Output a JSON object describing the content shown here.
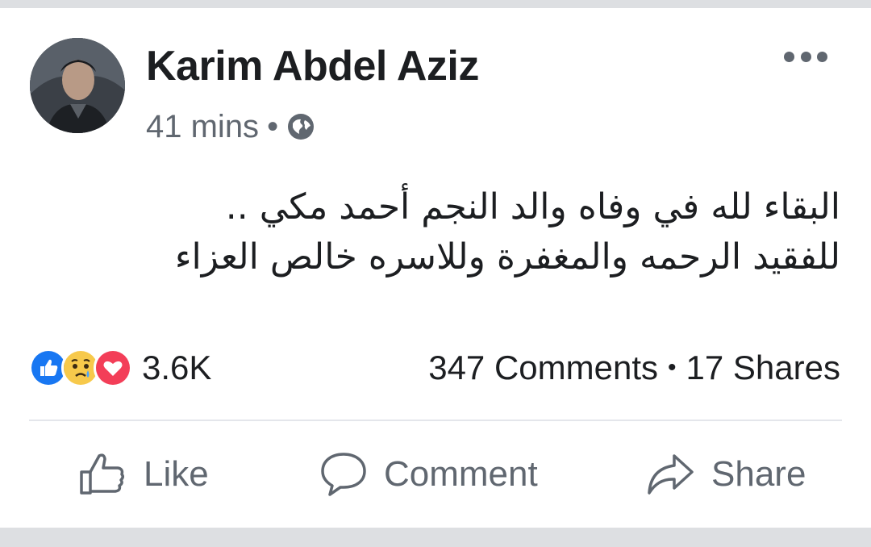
{
  "post": {
    "author": "Karim Abdel Aziz",
    "time": "41 mins",
    "separator": "•",
    "text_lines": [
      "البقاء لله في وفاه والد النجم أحمد مكي ..",
      "للفقيد الرحمه والمغفرة وللاسره خالص العزاء"
    ]
  },
  "reactions": {
    "types": [
      "like-icon",
      "sad-icon",
      "love-icon"
    ],
    "count": "3.6K"
  },
  "stats": {
    "comments": "347 Comments",
    "separator": "•",
    "shares": "17 Shares"
  },
  "actions": {
    "like": "Like",
    "comment": "Comment",
    "share": "Share"
  },
  "colors": {
    "text": "#1c1e21",
    "secondary": "#606770",
    "like_blue": "#1877f2",
    "love_red": "#f33e58",
    "sad_yellow": "#f7c94b",
    "strip": "#dddfe2"
  }
}
